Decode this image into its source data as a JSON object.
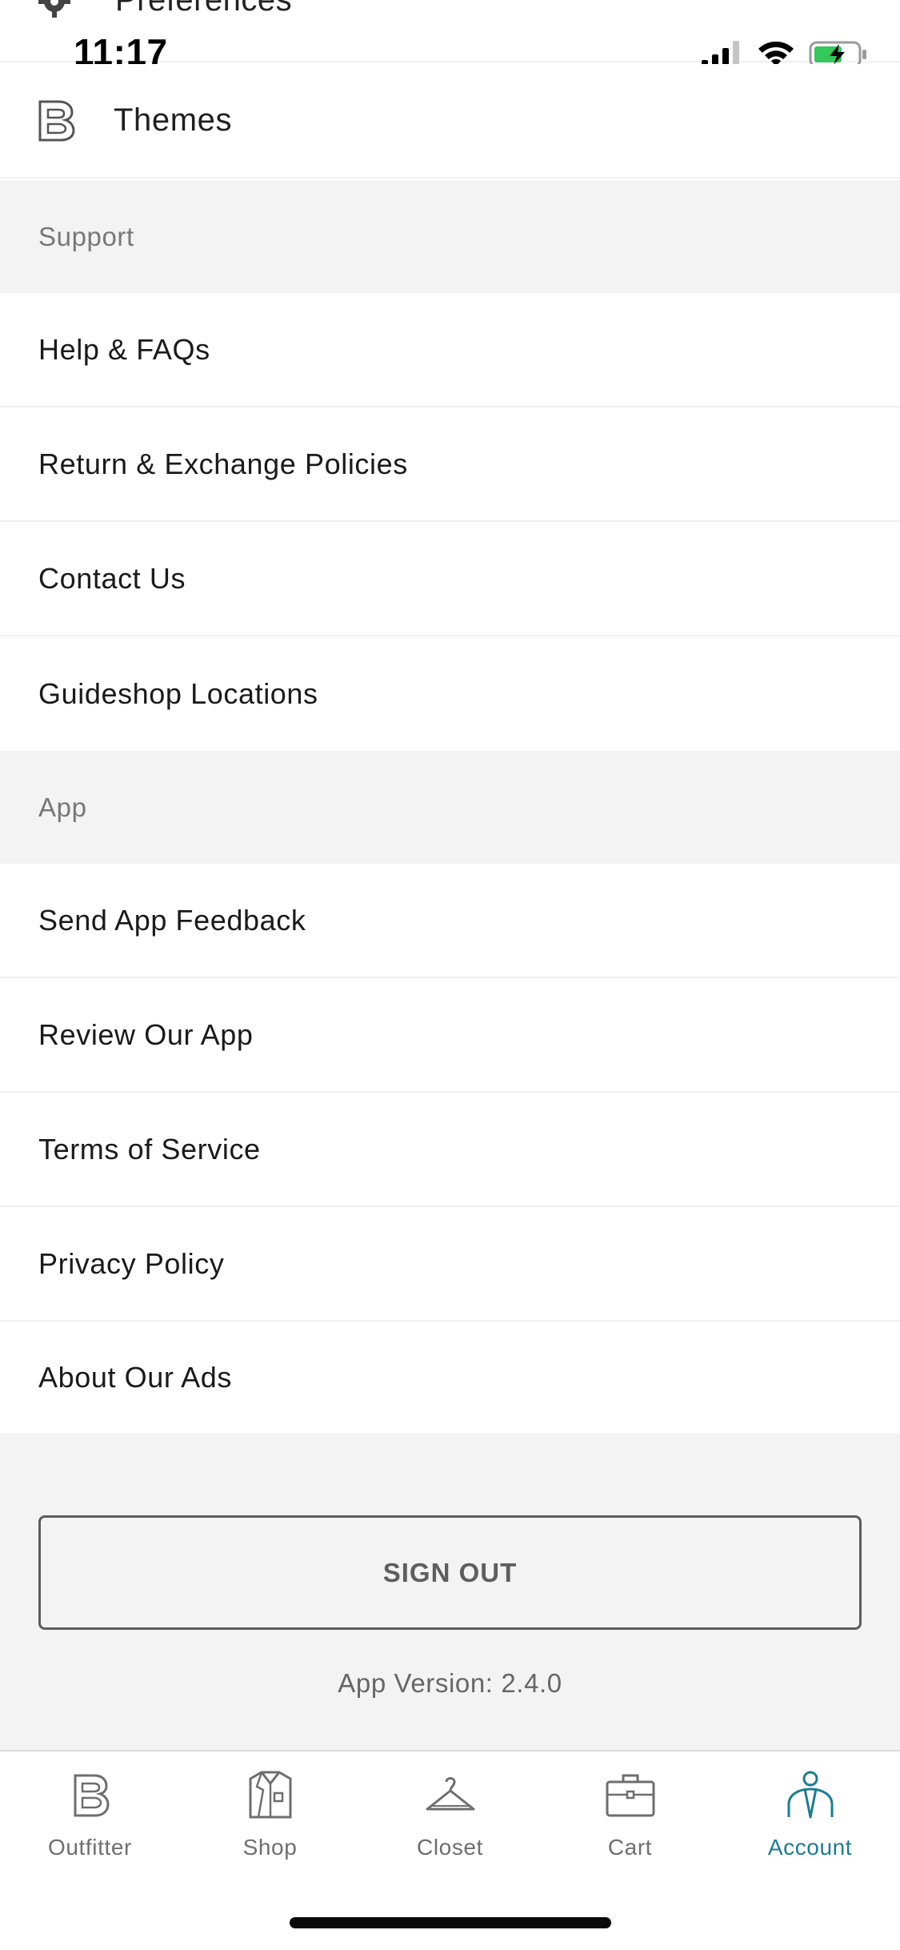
{
  "status_bar": {
    "time": "11:17"
  },
  "partial_row": {
    "label": "Preferences",
    "icon": "gear-icon"
  },
  "themes_row": {
    "label": "Themes",
    "icon": "bonobos-b-icon"
  },
  "sections": {
    "support": {
      "header": "Support",
      "items": [
        "Help & FAQs",
        "Return & Exchange Policies",
        "Contact Us",
        "Guideshop Locations"
      ]
    },
    "app": {
      "header": "App",
      "items": [
        "Send App Feedback",
        "Review Our App",
        "Terms of Service",
        "Privacy Policy",
        "About Our Ads"
      ]
    }
  },
  "sign_out": {
    "label": "SIGN OUT"
  },
  "app_version": "App Version: 2.4.0",
  "tabbar": {
    "tabs": [
      {
        "label": "Outfitter",
        "icon": "bonobos-b-icon"
      },
      {
        "label": "Shop",
        "icon": "shirt-icon"
      },
      {
        "label": "Closet",
        "icon": "hanger-icon"
      },
      {
        "label": "Cart",
        "icon": "briefcase-icon"
      },
      {
        "label": "Account",
        "icon": "person-icon"
      }
    ],
    "active_index": 4,
    "active_color": "#1b7d92",
    "inactive_color": "#6e6e6e"
  }
}
